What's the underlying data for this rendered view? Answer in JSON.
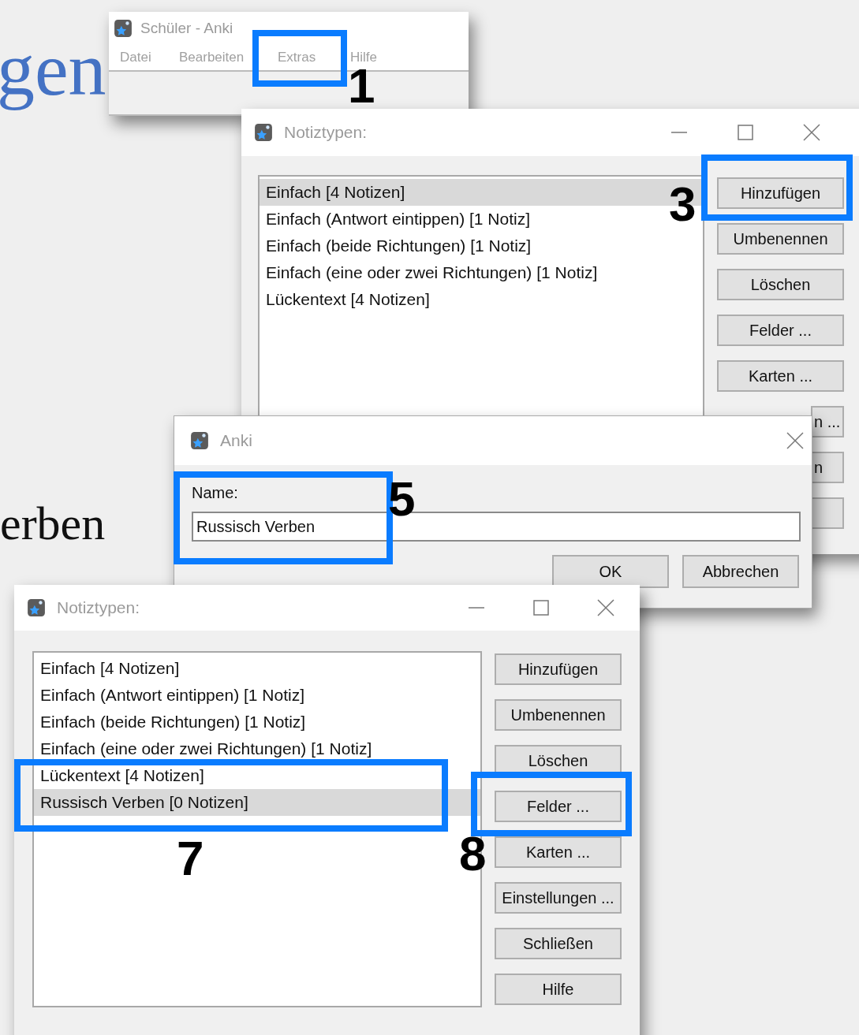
{
  "slide_fragments": [
    "gen",
    "erben"
  ],
  "main_window": {
    "title": "Schüler - Anki",
    "menu": [
      "Datei",
      "Bearbeiten",
      "Extras",
      "Hilfe"
    ]
  },
  "note_types_window_top": {
    "title": "Notiztypen:",
    "items": [
      {
        "label": "Einfach [4 Notizen]",
        "selected": true
      },
      {
        "label": "Einfach (Antwort eintippen) [1 Notiz]",
        "selected": false
      },
      {
        "label": "Einfach (beide Richtungen) [1 Notiz]",
        "selected": false
      },
      {
        "label": "Einfach (eine oder zwei Richtungen) [1 Notiz]",
        "selected": false
      },
      {
        "label": "Lückentext [4 Notizen]",
        "selected": false
      }
    ],
    "buttons": [
      {
        "label": "Hinzufügen",
        "kind": "full"
      },
      {
        "label": "Umbenennen",
        "kind": "full"
      },
      {
        "label": "Löschen",
        "kind": "full"
      },
      {
        "label": "Felder ...",
        "kind": "full"
      },
      {
        "label": "Karten ...",
        "kind": "full"
      },
      {
        "label": "n ...",
        "kind": "cut"
      },
      {
        "label": "n",
        "kind": "cut"
      },
      {
        "kind": "cut"
      }
    ]
  },
  "name_dialog": {
    "title": "Anki",
    "label": "Name:",
    "value": "Russisch Verben",
    "buttons": [
      "OK",
      "Abbrechen"
    ]
  },
  "note_types_window_bottom": {
    "title": "Notiztypen:",
    "items": [
      {
        "label": "Einfach [4 Notizen]",
        "selected": false
      },
      {
        "label": "Einfach (Antwort eintippen) [1 Notiz]",
        "selected": false
      },
      {
        "label": "Einfach (beide Richtungen) [1 Notiz]",
        "selected": false
      },
      {
        "label": "Einfach (eine oder zwei Richtungen) [1 Notiz]",
        "selected": false
      },
      {
        "label": "Lückentext [4 Notizen]",
        "selected": false
      },
      {
        "label": "Russisch Verben [0 Notizen]",
        "selected": true
      }
    ],
    "buttons": [
      {
        "label": "Hinzufügen",
        "kind": "full"
      },
      {
        "label": "Umbenennen",
        "kind": "full"
      },
      {
        "label": "Löschen",
        "kind": "full"
      },
      {
        "label": "Felder ...",
        "kind": "full"
      },
      {
        "label": "Karten ...",
        "kind": "full"
      },
      {
        "label": "Einstellungen ...",
        "kind": "full"
      },
      {
        "label": "Schließen",
        "kind": "full"
      },
      {
        "label": "Hilfe",
        "kind": "full"
      }
    ]
  },
  "annotations": [
    {
      "number": "1"
    },
    {
      "number": "3"
    },
    {
      "number": "5"
    },
    {
      "number": "7"
    },
    {
      "number": "8"
    }
  ]
}
